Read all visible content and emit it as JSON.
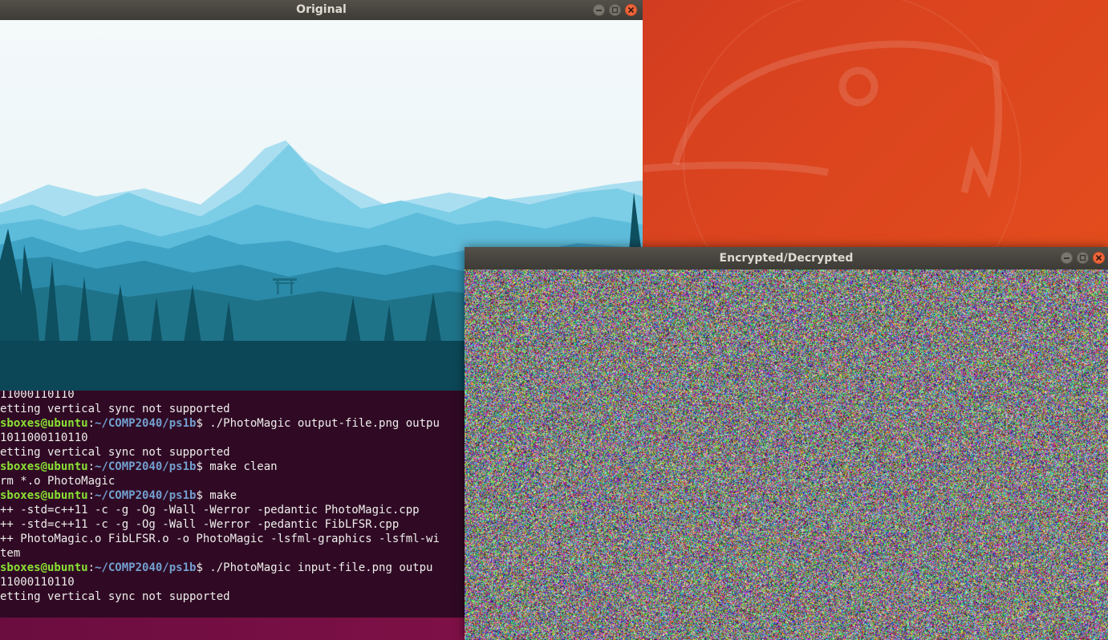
{
  "windows": {
    "original": {
      "title": "Original",
      "image_description_icon": "mountain-landscape-image"
    },
    "encrypted": {
      "title": "Encrypted/Decrypted",
      "image_description_icon": "noise-image"
    }
  },
  "terminal": {
    "lines": [
      {
        "type": "out",
        "text": "11000110110"
      },
      {
        "type": "out",
        "text": "etting vertical sync not supported"
      },
      {
        "type": "prompt",
        "user": "sboxes@ubuntu",
        "path": "~/COMP2040/ps1b",
        "cmd": "$ ./PhotoMagic output-file.png outpu"
      },
      {
        "type": "out",
        "text": "1011000110110"
      },
      {
        "type": "out",
        "text": "etting vertical sync not supported"
      },
      {
        "type": "prompt",
        "user": "sboxes@ubuntu",
        "path": "~/COMP2040/ps1b",
        "cmd": "$ make clean"
      },
      {
        "type": "out",
        "text": "rm *.o PhotoMagic"
      },
      {
        "type": "prompt",
        "user": "sboxes@ubuntu",
        "path": "~/COMP2040/ps1b",
        "cmd": "$ make"
      },
      {
        "type": "out",
        "text": "++ -std=c++11 -c -g -Og -Wall -Werror -pedantic PhotoMagic.cpp"
      },
      {
        "type": "out",
        "text": "++ -std=c++11 -c -g -Og -Wall -Werror -pedantic FibLFSR.cpp"
      },
      {
        "type": "out",
        "text": "++ PhotoMagic.o FibLFSR.o -o PhotoMagic -lsfml-graphics -lsfml-wi"
      },
      {
        "type": "out",
        "text": "tem"
      },
      {
        "type": "prompt",
        "user": "sboxes@ubuntu",
        "path": "~/COMP2040/ps1b",
        "cmd": "$ ./PhotoMagic input-file.png outpu"
      },
      {
        "type": "out",
        "text": "11000110110"
      },
      {
        "type": "out",
        "text": "etting vertical sync not supported"
      }
    ]
  },
  "colors": {
    "terminal_bg": "#300a24",
    "prompt_user": "#8ae234",
    "prompt_path": "#729fcf",
    "close_button": "#f0663b",
    "titlebar": "#3d3b37"
  }
}
